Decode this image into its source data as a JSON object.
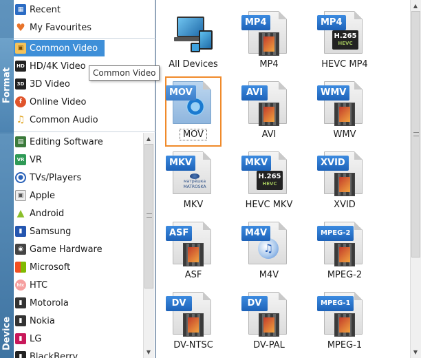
{
  "tabs": {
    "format": "Format",
    "device": "Device"
  },
  "left_top": [
    {
      "label": "Recent",
      "icon": "recent-icon",
      "color": "#2b6cc4"
    },
    {
      "label": "My Favourites",
      "icon": "heart-icon",
      "color": "#e8732a"
    }
  ],
  "format_items": [
    {
      "label": "Common Video",
      "icon": "film-icon",
      "selected": true
    },
    {
      "label": "HD/4K Video",
      "icon": "hd-icon",
      "selected": false
    },
    {
      "label": "3D Video",
      "icon": "3d-icon",
      "selected": false
    },
    {
      "label": "Online Video",
      "icon": "online-video-icon",
      "selected": false
    },
    {
      "label": "Common Audio",
      "icon": "music-note-icon",
      "selected": false
    }
  ],
  "device_items": [
    {
      "label": "Editing Software",
      "icon": "editing-software-icon"
    },
    {
      "label": "VR",
      "icon": "vr-icon"
    },
    {
      "label": "TVs/Players",
      "icon": "tv-icon"
    },
    {
      "label": "Apple",
      "icon": "apple-icon"
    },
    {
      "label": "Android",
      "icon": "android-icon"
    },
    {
      "label": "Samsung",
      "icon": "samsung-icon"
    },
    {
      "label": "Game Hardware",
      "icon": "game-hardware-icon"
    },
    {
      "label": "Microsoft",
      "icon": "microsoft-icon"
    },
    {
      "label": "HTC",
      "icon": "htc-icon"
    },
    {
      "label": "Motorola",
      "icon": "motorola-icon"
    },
    {
      "label": "Nokia",
      "icon": "nokia-icon"
    },
    {
      "label": "LG",
      "icon": "lg-icon"
    },
    {
      "label": "BlackBerry",
      "icon": "blackberry-icon"
    }
  ],
  "tooltip": "Common Video",
  "grid": [
    {
      "label": "All Devices",
      "badge": "",
      "kind": "devices"
    },
    {
      "label": "MP4",
      "badge": "MP4",
      "kind": "film"
    },
    {
      "label": "HEVC MP4",
      "badge": "MP4",
      "kind": "hevc"
    },
    {
      "label": "MOV",
      "badge": "MOV",
      "kind": "quicktime",
      "selected": true
    },
    {
      "label": "AVI",
      "badge": "AVI",
      "kind": "film"
    },
    {
      "label": "WMV",
      "badge": "WMV",
      "kind": "film"
    },
    {
      "label": "MKV",
      "badge": "MKV",
      "kind": "matroska"
    },
    {
      "label": "HEVC MKV",
      "badge": "MKV",
      "kind": "hevc"
    },
    {
      "label": "XVID",
      "badge": "XVID",
      "kind": "film"
    },
    {
      "label": "ASF",
      "badge": "ASF",
      "kind": "film"
    },
    {
      "label": "M4V",
      "badge": "M4V",
      "kind": "itunes"
    },
    {
      "label": "MPEG-2",
      "badge": "MPEG-2",
      "kind": "film"
    },
    {
      "label": "DV-NTSC",
      "badge": "DV",
      "kind": "film"
    },
    {
      "label": "DV-PAL",
      "badge": "DV",
      "kind": "film"
    },
    {
      "label": "MPEG-1",
      "badge": "MPEG-1",
      "kind": "film"
    }
  ],
  "hevc_text": {
    "top": "H.265",
    "bottom": "HEVC"
  },
  "matroska_text": "матрёшка MATROSKA",
  "colors": {
    "accent": "#3e8fd8",
    "selection_border": "#f08a2a",
    "badge": "#2a75cf"
  }
}
